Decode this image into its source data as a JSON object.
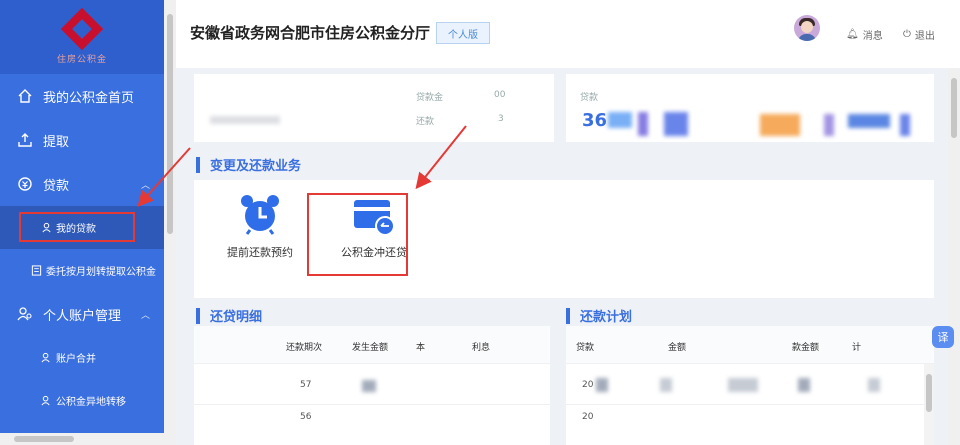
{
  "sidebar": {
    "logo_text": "住房公积金",
    "items": [
      {
        "label": "我的公积金首页",
        "icon": "home-icon"
      },
      {
        "label": "提取",
        "icon": "upload-icon"
      },
      {
        "label": "贷款",
        "icon": "loan-icon"
      },
      {
        "label": "个人账户管理",
        "icon": "user-group-icon"
      }
    ],
    "loan_sub": [
      {
        "label": "我的贷款",
        "icon": "user-circle-icon"
      },
      {
        "label": "委托按月划转提取公积金",
        "icon": "document-icon"
      }
    ],
    "account_sub": [
      {
        "label": "账户合并",
        "icon": "user-icon"
      },
      {
        "label": "公积金异地转移",
        "icon": "user-icon"
      }
    ]
  },
  "header": {
    "title": "安徽省政务网合肥市住房公积金分厅",
    "version_badge": "个人版",
    "message_label": "消息",
    "logout_label": "退出"
  },
  "loan_summary": {
    "left_label_1": "贷款金",
    "left_value_1": "00",
    "left_label_2": "还款",
    "left_value_2": "3",
    "right_label": "贷款",
    "right_amount": "36"
  },
  "business_section": {
    "title": "变更及还款业务",
    "items": [
      {
        "label": "提前还款预约",
        "icon": "alarm-clock-icon"
      },
      {
        "label": "公积金冲还贷",
        "icon": "card-refund-icon"
      }
    ]
  },
  "repay_detail": {
    "title": "还贷明细",
    "headers": [
      "还款期次",
      "发生金额",
      "本",
      "利息"
    ],
    "rows": [
      [
        "57"
      ],
      [
        "56"
      ]
    ]
  },
  "repay_plan": {
    "title": "还款计划",
    "headers": [
      "贷款",
      "金额",
      "款金额",
      "计"
    ],
    "rows": [
      [
        "20"
      ],
      [
        "20"
      ]
    ]
  },
  "translate_label": "译",
  "colors": {
    "sidebar": "#3a6fe0",
    "accent": "#3a6fe0",
    "annotation": "#e53935"
  }
}
